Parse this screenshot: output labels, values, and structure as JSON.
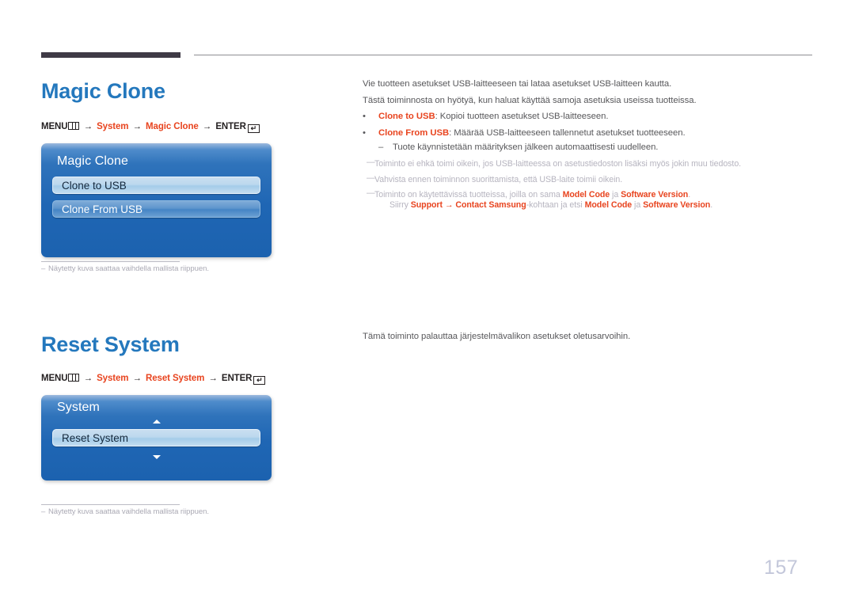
{
  "document": {
    "page_number": "157",
    "accent_color": "#e8441f",
    "title_color": "#2478bd",
    "note_color": "#b6b4bf",
    "body_color": "#58585b"
  },
  "sections": [
    {
      "title": "Magic Clone",
      "menu_path": {
        "menu_label": "MENU",
        "menu_icon": "menu-bars-icon",
        "arrow": "→",
        "steps": [
          "System",
          "Magic Clone"
        ],
        "enter_label": "ENTER",
        "enter_icon": "enter-return-icon",
        "enter_glyph": "↵"
      },
      "osd": {
        "title": "Magic Clone",
        "rows": [
          {
            "label": "Clone to USB",
            "state": "selected"
          },
          {
            "label": "Clone From USB",
            "state": "normal"
          }
        ],
        "scroll_up_icon": "",
        "scroll_down_icon": ""
      },
      "footnote": "Näytetty kuva saattaa vaihdella mallista riippuen."
    },
    {
      "title": "Reset System",
      "menu_path": {
        "menu_label": "MENU",
        "menu_icon": "menu-bars-icon",
        "arrow": "→",
        "steps": [
          "System",
          "Reset System"
        ],
        "enter_label": "ENTER",
        "enter_icon": "enter-return-icon",
        "enter_glyph": "↵"
      },
      "osd": {
        "title": "System",
        "rows": [
          {
            "label": "Reset System",
            "state": "selected"
          }
        ],
        "scroll_up_icon": "chevron-up-icon",
        "scroll_down_icon": "chevron-down-icon"
      },
      "footnote": "Näytetty kuva saattaa vaihdella mallista riippuen."
    }
  ],
  "magic_clone_content": {
    "intro_1": "Vie tuotteen asetukset USB-laitteeseen tai lataa asetukset USB-laitteen kautta.",
    "intro_2": "Tästä toiminnosta on hyötyä, kun haluat käyttää samoja asetuksia useissa tuotteissa.",
    "bullet_marker": "•",
    "bullets": [
      {
        "term": "Clone to USB",
        "text": ": Kopioi tuotteen asetukset USB-laitteeseen."
      },
      {
        "term": "Clone From USB",
        "text": ": Määrää USB-laitteeseen tallennetut asetukset tuotteeseen."
      }
    ],
    "sub_dash_marker": "–",
    "sub_dashes": [
      "Tuote käynnistetään määrityksen jälkeen automaattisesti uudelleen."
    ],
    "note_marker": "—",
    "notes": [
      {
        "text": "Toiminto ei ehkä toimi oikein, jos USB-laitteessa on asetustiedoston lisäksi myös jokin muu tiedosto."
      },
      {
        "text": "Vahvista ennen toiminnon suorittamista, että USB-laite toimii oikein."
      }
    ],
    "note_model": {
      "prefix": "Toiminto on käytettävissä tuotteissa, joilla on sama ",
      "term_1": "Model Code",
      "join": " ja ",
      "term_2": "Software Version",
      "suffix": "."
    },
    "note_model_line2": {
      "prefix": "Siirry ",
      "term_1": "Support",
      "arrow": " → ",
      "term_2": "Contact Samsung",
      "mid": "-kohtaan ja etsi ",
      "term_3": "Model Code",
      "join": " ja ",
      "term_4": "Software Version",
      "suffix": "."
    }
  },
  "reset_system_content": {
    "description": "Tämä toiminto palauttaa järjestelmävalikon asetukset oletusarvoihin."
  }
}
